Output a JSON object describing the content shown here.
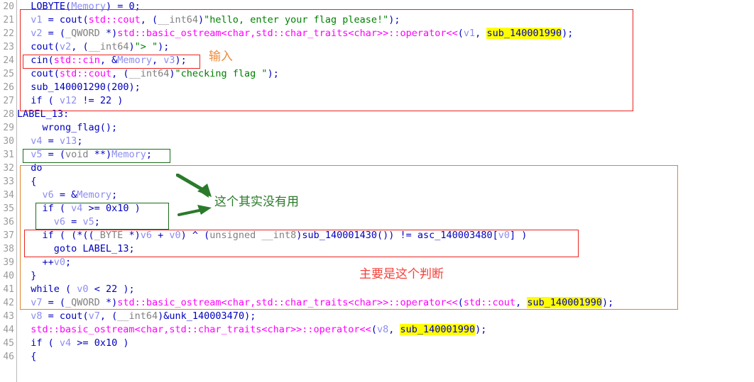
{
  "view": {
    "name": "ida-pseudocode-view",
    "background_color": "#ffffff",
    "gutter_color": "#9a9a9a",
    "first_line": 20,
    "last_line": 46
  },
  "colors": {
    "keyword": "#0000c0",
    "variable": "#8c8cf0",
    "namespace": "#ff00ff",
    "string": "#008000",
    "type": "#808080",
    "highlight": "#ffff00",
    "box_red": "#e8241f",
    "box_green": "#1b6b1b",
    "box_orange": "#e08426",
    "note_orange": "#ed8c3c",
    "note_green": "#2b7a2b",
    "note_red": "#f4403a"
  },
  "line_numbers": [
    20,
    21,
    22,
    23,
    24,
    25,
    26,
    27,
    28,
    29,
    30,
    31,
    32,
    33,
    34,
    35,
    36,
    37,
    38,
    39,
    40,
    41,
    42,
    43,
    44,
    45,
    46
  ],
  "code_lines": [
    {
      "n": 20,
      "text": "  LOBYTE(Memory) = 0;"
    },
    {
      "n": 21,
      "text": "  v1 = cout(std::cout, (__int64)\"hello, enter your flag please!\");"
    },
    {
      "n": 22,
      "text": "  v2 = (_QWORD *)std::basic_ostream<char,std::char_traits<char>>::operator<<(v1, sub_140001990);"
    },
    {
      "n": 23,
      "text": "  cout(v2, (__int64)\"> \");"
    },
    {
      "n": 24,
      "text": "  cin(std::cin, &Memory, v3);"
    },
    {
      "n": 25,
      "text": "  cout(std::cout, (__int64)\"checking flag \");"
    },
    {
      "n": 26,
      "text": "  sub_140001290(200);"
    },
    {
      "n": 27,
      "text": "  if ( v12 != 22 )"
    },
    {
      "n": 28,
      "text": "LABEL_13:"
    },
    {
      "n": 29,
      "text": "    wrong_flag();"
    },
    {
      "n": 30,
      "text": "  v4 = v13;"
    },
    {
      "n": 31,
      "text": "  v5 = (void **)Memory;"
    },
    {
      "n": 32,
      "text": "  do"
    },
    {
      "n": 33,
      "text": "  {"
    },
    {
      "n": 34,
      "text": "    v6 = &Memory;"
    },
    {
      "n": 35,
      "text": "    if ( v4 >= 0x10 )"
    },
    {
      "n": 36,
      "text": "      v6 = v5;"
    },
    {
      "n": 37,
      "text": "    if ( (*((_BYTE *)v6 + v0) ^ (unsigned __int8)sub_140001430()) != asc_140003480[v0] )"
    },
    {
      "n": 38,
      "text": "      goto LABEL_13;"
    },
    {
      "n": 39,
      "text": "    ++v0;"
    },
    {
      "n": 40,
      "text": "  }"
    },
    {
      "n": 41,
      "text": "  while ( v0 < 22 );"
    },
    {
      "n": 42,
      "text": "  v7 = (_QWORD *)std::basic_ostream<char,std::char_traits<char>>::operator<<(std::cout, sub_140001990);"
    },
    {
      "n": 43,
      "text": "  v8 = cout(v7, (__int64)&unk_140003470);"
    },
    {
      "n": 44,
      "text": "  std::basic_ostream<char,std::char_traits<char>>::operator<<(v8, sub_140001990);"
    },
    {
      "n": 45,
      "text": "  if ( v4 >= 0x10 )"
    },
    {
      "n": 46,
      "text": "  {"
    }
  ],
  "symbols": {
    "highlighted_symbol": "sub_140001990",
    "functions": [
      "LOBYTE",
      "cout",
      "cin",
      "sub_140001290",
      "wrong_flag",
      "sub_140001430",
      "sub_140001990"
    ],
    "data_refs": [
      "asc_140003480",
      "unk_140003470",
      "Memory"
    ],
    "label": "LABEL_13",
    "variables": [
      "v0",
      "v1",
      "v2",
      "v3",
      "v4",
      "v5",
      "v6",
      "v7",
      "v8",
      "v12",
      "v13"
    ],
    "strings": [
      "hello, enter your flag please!",
      "> ",
      "checking flag "
    ],
    "constants": [
      "0",
      "22",
      "200",
      "0x10"
    ]
  },
  "annotations": [
    {
      "id": "note-input",
      "text": "输入",
      "color": "#ed8c3c",
      "refers_to_line": 24
    },
    {
      "id": "note-useless",
      "text": "这个其实没有用",
      "color": "#2b7a2b",
      "refers_to_line": 35
    },
    {
      "id": "note-main",
      "text": "主要是这个判断",
      "color": "#f4403a",
      "refers_to_line": 37
    }
  ],
  "highlight_boxes": [
    {
      "id": "box-input-block",
      "color": "#e8241f",
      "lines": "21-27"
    },
    {
      "id": "box-cin-line",
      "color": "#e8241f",
      "lines": "24"
    },
    {
      "id": "box-v5-assign",
      "color": "#1b6b1b",
      "lines": "31"
    },
    {
      "id": "box-do-while-loop",
      "color": "#e08426",
      "lines": "32-41"
    },
    {
      "id": "box-if-v4-ge-10",
      "color": "#1b6b1b",
      "lines": "35-36"
    },
    {
      "id": "box-xor-check",
      "color": "#e8241f",
      "lines": "37-38"
    }
  ],
  "arrows": [
    {
      "id": "arrow-to-loop",
      "color": "#2b7a2b",
      "direction": "down-right"
    },
    {
      "id": "arrow-to-useless",
      "color": "#2b7a2b",
      "direction": "right"
    }
  ]
}
